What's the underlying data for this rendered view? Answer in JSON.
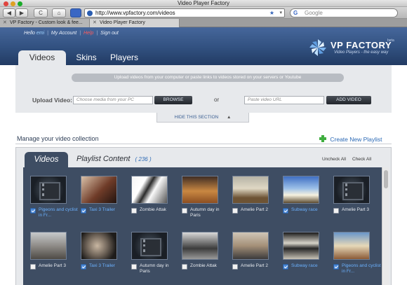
{
  "browser": {
    "window_title": "Video Player Factory",
    "url": "http://www.vpfactory.com/videos",
    "search_placeholder": "Google",
    "search_engine_letter": "G",
    "tabs": [
      {
        "label": "VP Factory - Custom look & fee..."
      },
      {
        "label": "Video Player Factory"
      }
    ],
    "nav": {
      "back": "◀",
      "forward": "▶",
      "reload": "C",
      "home": "⌂",
      "star": "★",
      "dropdown": "▾",
      "close_tab": "✕"
    }
  },
  "header": {
    "greeting": "Hello",
    "username": "emi",
    "links": [
      "My Account",
      "Help",
      "Sign out"
    ],
    "logo": {
      "name": "VP FACTORY",
      "tagline": "Video Players - the easy way",
      "badge": "beta"
    },
    "tabs": [
      {
        "label": "Videos",
        "active": true
      },
      {
        "label": "Skins",
        "active": false
      },
      {
        "label": "Players",
        "active": false
      }
    ]
  },
  "upload": {
    "instructions": "Upload videos from your computer or paste links to videos stored on your servers or Youtube",
    "label": "Upload Video:",
    "media_placeholder": "Choose media from your PC",
    "browse_label": "BROWSE",
    "or_label": "or",
    "url_placeholder": "Paste video URL",
    "add_label": "ADD VIDEO",
    "hide_label": "HIDE THIS SECTION",
    "hide_arrow": "▲"
  },
  "manage": {
    "title": "Manage your video collection",
    "create_playlist": "Create New Playlist",
    "videos_tab": "Videos",
    "playlist_content_label": "Playlist Content",
    "playlist_count": "( 236 )",
    "uncheck_all": "Uncheck All",
    "check_all": "Check All"
  },
  "videos": [
    {
      "title": "Pigeons and cyclist in Fr...",
      "checked": true,
      "thumb": "film"
    },
    {
      "title": "Taxi 3 Trailer",
      "checked": true,
      "thumb": "a"
    },
    {
      "title": "Zombie Attak",
      "checked": false,
      "thumb": "b"
    },
    {
      "title": "Autumn day in Paris",
      "checked": false,
      "thumb": "c"
    },
    {
      "title": "Amelie Part 2",
      "checked": false,
      "thumb": "d"
    },
    {
      "title": "Subway race",
      "checked": true,
      "thumb": "e"
    },
    {
      "title": "Amelie Part 3",
      "checked": false,
      "thumb": "film"
    },
    {
      "title": "Amelie Part 3",
      "checked": false,
      "thumb": "f"
    },
    {
      "title": "Taxi 3 Trailer",
      "checked": true,
      "thumb": "g"
    },
    {
      "title": "Autumn day in Paris",
      "checked": false,
      "thumb": "film"
    },
    {
      "title": "Zombie Attak",
      "checked": false,
      "thumb": "h"
    },
    {
      "title": "Amelie Part 2",
      "checked": false,
      "thumb": "i"
    },
    {
      "title": "Subway race",
      "checked": true,
      "thumb": "j"
    },
    {
      "title": "Pigeons and cyclist in Fr...",
      "checked": true,
      "thumb": "k"
    }
  ]
}
